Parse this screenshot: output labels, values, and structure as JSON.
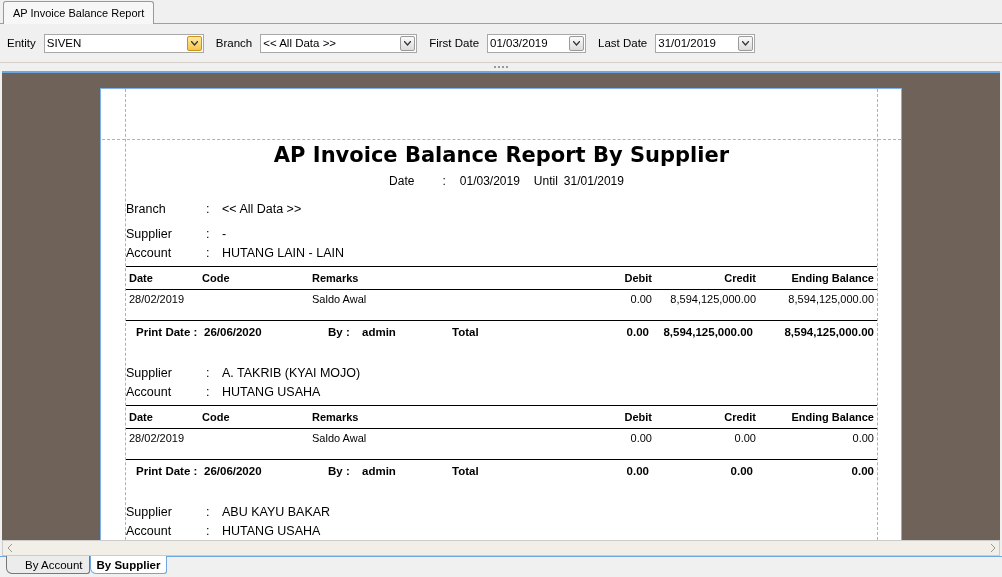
{
  "tabs": [
    {
      "label": "AP Invoice Balance Report",
      "selected": true
    }
  ],
  "filters": [
    {
      "label": "Entity",
      "value": "SIVEN",
      "focused": true
    },
    {
      "label": "Branch",
      "value": "<< All Data >>",
      "focused": false
    },
    {
      "label": "First Date",
      "value": "01/03/2019",
      "focused": false
    },
    {
      "label": "Last Date",
      "value": "31/01/2019",
      "focused": false
    }
  ],
  "report": {
    "title": "AP Invoice Balance Report By Supplier",
    "date_label": "Date",
    "date_colon": ":",
    "date_from": "01/03/2019",
    "until_label": "Until",
    "date_to": "31/01/2019",
    "branch": {
      "label": "Branch",
      "colon": ":",
      "value": "<< All Data >>"
    },
    "groups": [
      {
        "supplier_label": "Supplier",
        "supplier": "-",
        "account_label": "Account",
        "account": "HUTANG LAIN - LAIN",
        "colon": ":",
        "columns": [
          "Date",
          "Code",
          "Remarks",
          "Debit",
          "Credit",
          "Ending Balance"
        ],
        "rows": [
          [
            "28/02/2019",
            "",
            "Saldo Awal",
            "0.00",
            "8,594,125,000.00",
            "8,594,125,000.00"
          ]
        ],
        "footer": {
          "print_date_label": "Print Date :",
          "print_date": "26/06/2020",
          "by_label": "By :",
          "by": "admin",
          "total_label": "Total",
          "debit": "0.00",
          "credit": "8,594,125,000.00",
          "ending": "8,594,125,000.00"
        }
      },
      {
        "supplier_label": "Supplier",
        "supplier": "A. TAKRIB (KYAI MOJO)",
        "account_label": "Account",
        "account": "HUTANG USAHA",
        "colon": ":",
        "columns": [
          "Date",
          "Code",
          "Remarks",
          "Debit",
          "Credit",
          "Ending Balance"
        ],
        "rows": [
          [
            "28/02/2019",
            "",
            "Saldo Awal",
            "0.00",
            "0.00",
            "0.00"
          ]
        ],
        "footer": {
          "print_date_label": "Print Date :",
          "print_date": "26/06/2020",
          "by_label": "By :",
          "by": "admin",
          "total_label": "Total",
          "debit": "0.00",
          "credit": "0.00",
          "ending": "0.00"
        }
      },
      {
        "supplier_label": "Supplier",
        "supplier": "ABU KAYU BAKAR",
        "account_label": "Account",
        "account": "HUTANG USAHA",
        "colon": ":"
      }
    ]
  },
  "bottom_tabs": [
    {
      "label": "By Account",
      "selected": false
    },
    {
      "label": "By Supplier",
      "selected": true
    }
  ]
}
